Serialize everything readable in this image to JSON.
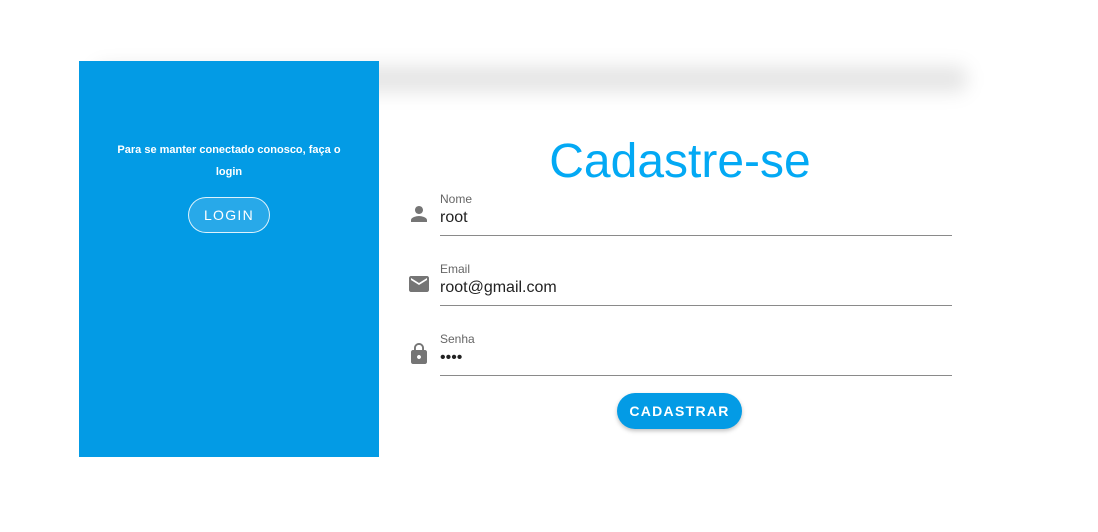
{
  "left_panel": {
    "message": "Para se manter conectado conosco, faça o login",
    "login_button": "LOGIN"
  },
  "form": {
    "title": "Cadastre-se",
    "fields": [
      {
        "label": "Nome",
        "value": "root",
        "icon": "person-icon"
      },
      {
        "label": "Email",
        "value": "root@gmail.com",
        "icon": "email-icon"
      },
      {
        "label": "Senha",
        "value": "••••",
        "icon": "lock-icon"
      }
    ],
    "submit_button": "CADASTRAR"
  },
  "colors": {
    "accent": "#039be5",
    "title": "#03a9f4",
    "icon": "#757575"
  }
}
